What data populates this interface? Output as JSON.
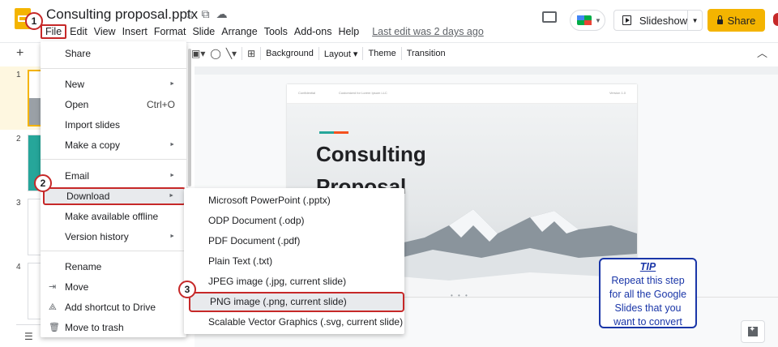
{
  "header": {
    "doc_title": "Consulting proposal.pptx",
    "menus": [
      "File",
      "Edit",
      "View",
      "Insert",
      "Format",
      "Slide",
      "Arrange",
      "Tools",
      "Add-ons",
      "Help"
    ],
    "last_edit": "Last edit was 2 days ago",
    "slideshow_label": "Slideshow",
    "share_label": "Share"
  },
  "toolbar": {
    "background_label": "Background",
    "layout_label": "Layout",
    "theme_label": "Theme",
    "transition_label": "Transition"
  },
  "filmstrip": {
    "slide_numbers": [
      "1",
      "2",
      "3",
      "4"
    ]
  },
  "slide": {
    "header_left": "Confidential",
    "header_mid": "Customized for Lorem Ipsum LLC",
    "header_right": "Version 1.0",
    "title_line1": "Consulting",
    "title_line2": "Proposal"
  },
  "file_menu": {
    "share": "Share",
    "new": "New",
    "open": "Open",
    "open_shortcut": "Ctrl+O",
    "import_slides": "Import slides",
    "make_copy": "Make a copy",
    "email": "Email",
    "download": "Download",
    "make_offline": "Make available offline",
    "version_history": "Version history",
    "rename": "Rename",
    "move": "Move",
    "add_shortcut": "Add shortcut to Drive",
    "move_trash": "Move to trash"
  },
  "download_menu": [
    "Microsoft PowerPoint (.pptx)",
    "ODP Document (.odp)",
    "PDF Document (.pdf)",
    "Plain Text (.txt)",
    "JPEG image (.jpg, current slide)",
    "PNG image (.png, current slide)",
    "Scalable Vector Graphics (.svg, current slide)"
  ],
  "steps": [
    "1",
    "2",
    "3"
  ],
  "tip": {
    "title": "TIP",
    "line1": "Repeat this step",
    "line2": "for all the Google",
    "line3": "Slides that you",
    "line4": "want to convert"
  },
  "colors": {
    "accent": "#f4b400",
    "highlight": "#c62828",
    "tip": "#1a36a8"
  }
}
